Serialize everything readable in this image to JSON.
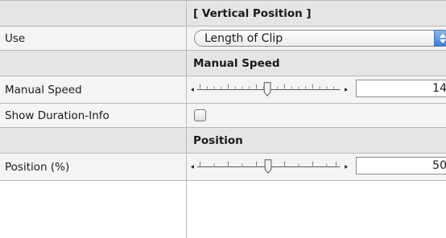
{
  "rows": {
    "vertical_header": {
      "label": "",
      "value": "[ Vertical Position ]"
    },
    "use": {
      "label": "Use",
      "selected": "Length of Clip"
    },
    "manual_speed_header": {
      "label": "",
      "value": "Manual Speed"
    },
    "manual_speed": {
      "label": "Manual Speed",
      "value": "14",
      "slider_fraction": 0.5
    },
    "show_duration": {
      "label": "Show Duration-Info",
      "checked": false
    },
    "position_header": {
      "label": "",
      "value": "Position"
    },
    "position": {
      "label": "Position (%)",
      "value": "50",
      "slider_fraction": 0.5
    }
  },
  "icons": {
    "popup_arrows": "stepper-arrows-icon",
    "slider_left": "triangle-left-icon",
    "slider_right": "triangle-right-icon"
  },
  "colors": {
    "accent": "#3e7fd3",
    "header_bg": "#e5e5e5",
    "row_bg": "#f4f4f4"
  }
}
